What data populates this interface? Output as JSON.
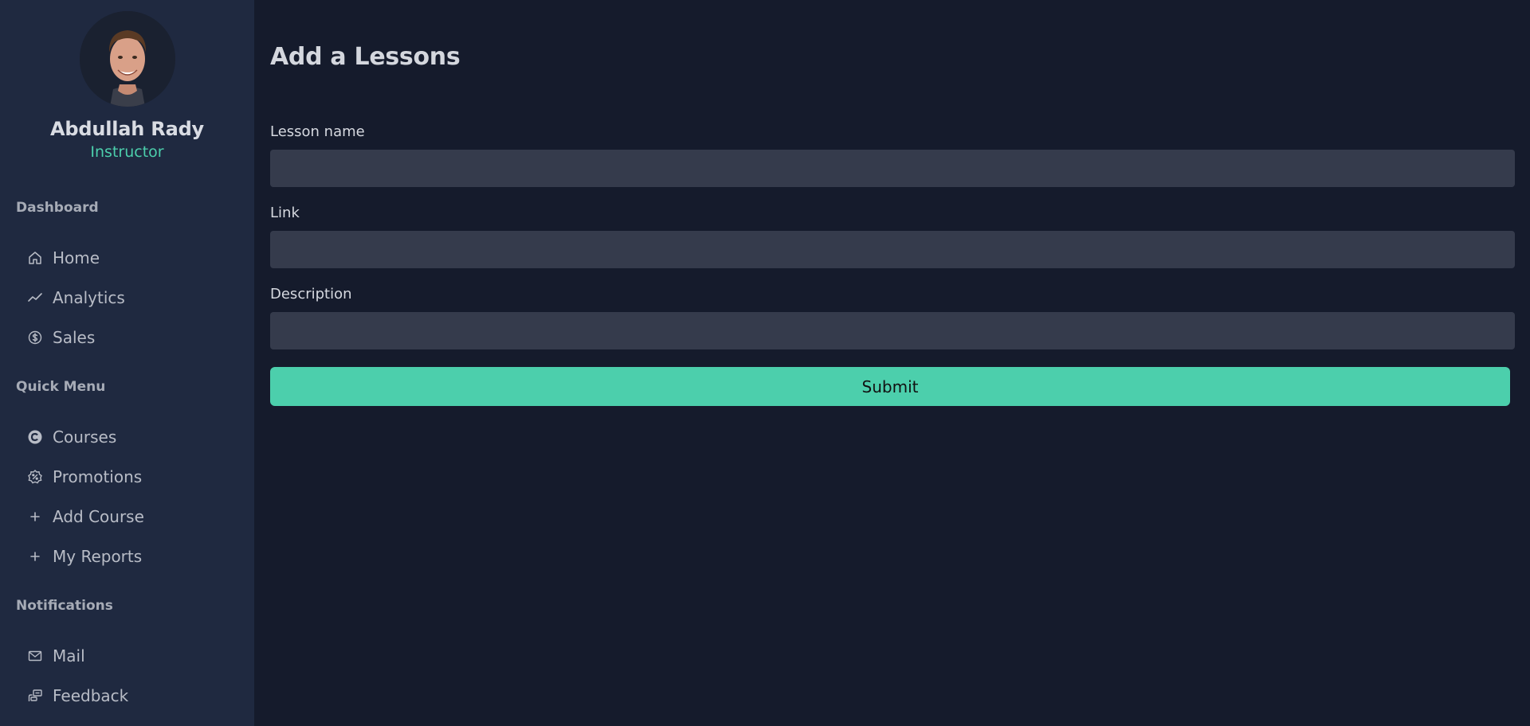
{
  "profile": {
    "name": "Abdullah Rady",
    "role": "Instructor"
  },
  "sidebar": {
    "sections": [
      {
        "title": "Dashboard",
        "items": [
          {
            "label": "Home",
            "icon": "home-icon"
          },
          {
            "label": "Analytics",
            "icon": "trending-line-icon"
          },
          {
            "label": "Sales",
            "icon": "dollar-circle-icon"
          }
        ]
      },
      {
        "title": "Quick Menu",
        "items": [
          {
            "label": "Courses",
            "icon": "copyright-icon"
          },
          {
            "label": "Promotions",
            "icon": "badge-percent-icon"
          },
          {
            "label": "Add Course",
            "icon": "plus-icon"
          },
          {
            "label": "My Reports",
            "icon": "plus-icon"
          }
        ]
      },
      {
        "title": "Notifications",
        "items": [
          {
            "label": "Mail",
            "icon": "mail-icon"
          },
          {
            "label": "Feedback",
            "icon": "feedback-icon"
          }
        ]
      }
    ]
  },
  "main": {
    "title": "Add a Lessons",
    "fields": [
      {
        "label": "Lesson name",
        "value": "",
        "placeholder": ""
      },
      {
        "label": "Link",
        "value": "",
        "placeholder": ""
      },
      {
        "label": "Description",
        "value": "",
        "placeholder": ""
      }
    ],
    "submit_label": "Submit"
  },
  "colors": {
    "sidebar_bg": "#1f2940",
    "main_bg": "#151b2c",
    "accent": "#4ccfac",
    "input_bg": "#353b4c"
  }
}
